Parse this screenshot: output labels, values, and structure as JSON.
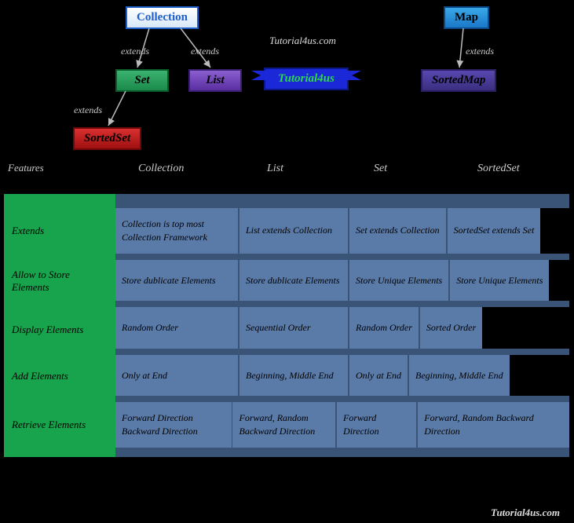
{
  "hierarchy": {
    "collection": "Collection",
    "set": "Set",
    "list": "List",
    "sortedset": "SortedSet",
    "map": "Map",
    "sortedmap": "SortedMap",
    "extends": "extends"
  },
  "tagline": "Tutorial4us.com",
  "ribbon": "Tutorial4us",
  "features_label": "Features",
  "col_headers": [
    "Collection",
    "List",
    "Set",
    "SortedSet"
  ],
  "rows": [
    {
      "feature": "Extends",
      "cells": [
        "Collection is top most Collection Framework",
        "List extends Collection",
        "Set extends Collection",
        "SortedSet extends Set"
      ]
    },
    {
      "feature": "Allow to Store Elements",
      "cells": [
        "Store dublicate Elements",
        "Store dublicate Elements",
        "Store Unique Elements",
        "Store Unique Elements"
      ]
    },
    {
      "feature": "Display Elements",
      "cells": [
        "Random Order",
        "Sequential Order",
        "Random Order",
        "Sorted Order"
      ]
    },
    {
      "feature": "Add Elements",
      "cells": [
        "Only at End",
        "Beginning, Middle End",
        "Only at End",
        "Beginning, Middle End"
      ]
    },
    {
      "feature": "Retrieve Elements",
      "cells": [
        "Forward Direction Backward Direction",
        "Forward, Random Backward Direction",
        "Forward Direction",
        "Forward, Random Backward Direction"
      ]
    }
  ],
  "footer": "Tutorial4us.com"
}
